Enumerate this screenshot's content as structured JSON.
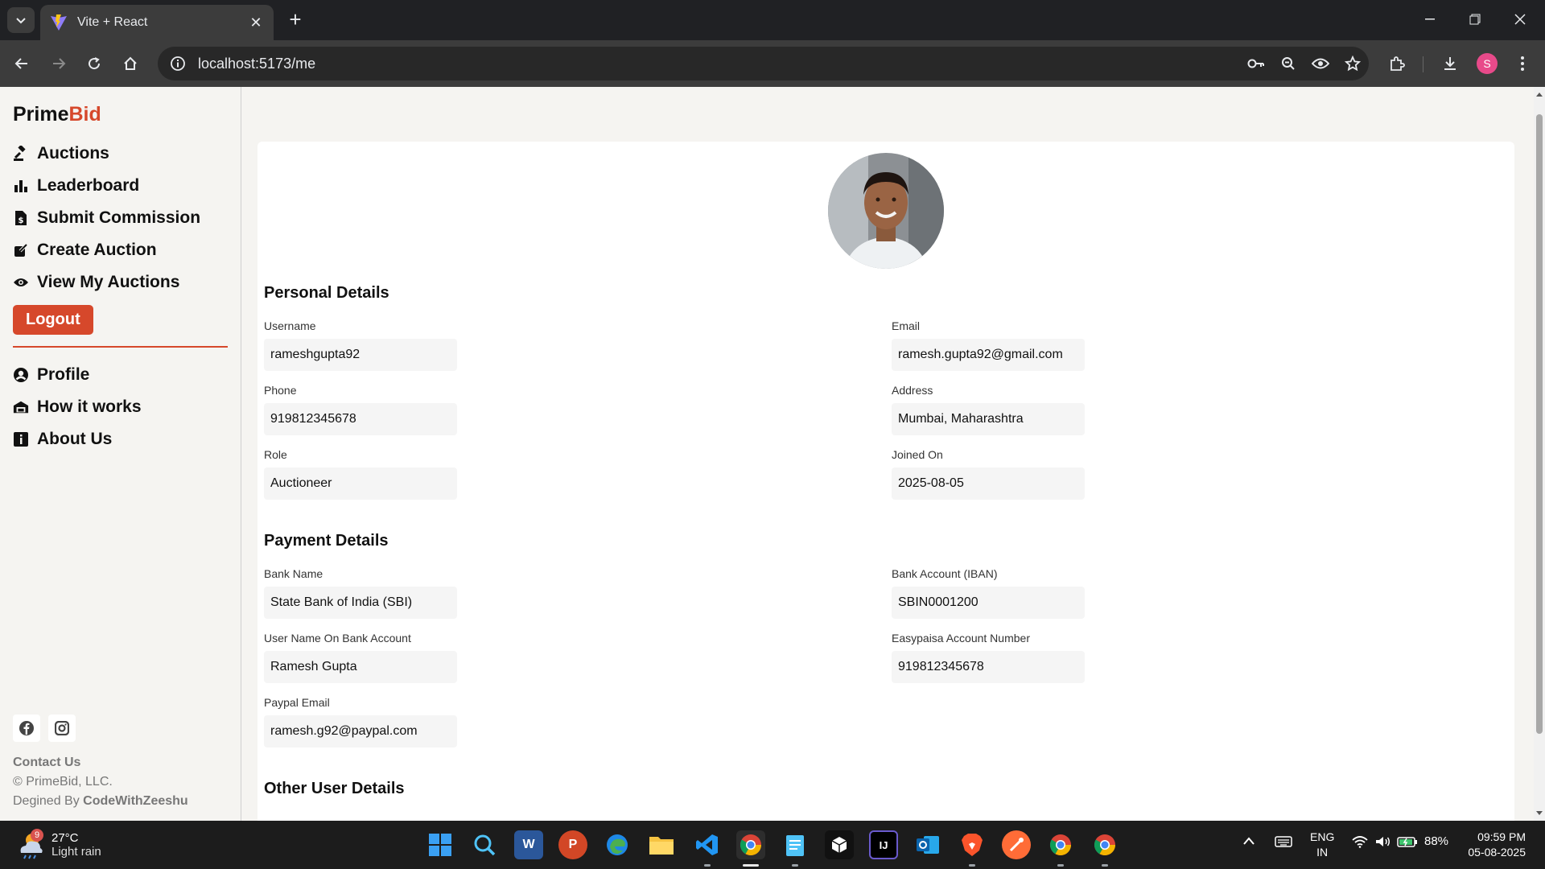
{
  "browser": {
    "tab_title": "Vite + React",
    "url": "localhost:5173/me",
    "profile_initial": "S"
  },
  "sidebar": {
    "brand_prefix": "Prime",
    "brand_accent": "Bid",
    "nav": [
      {
        "label": "Auctions",
        "icon": "gavel-icon"
      },
      {
        "label": "Leaderboard",
        "icon": "bar-chart-icon"
      },
      {
        "label": "Submit Commission",
        "icon": "file-dollar-icon"
      },
      {
        "label": "Create Auction",
        "icon": "edit-icon"
      },
      {
        "label": "View My Auctions",
        "icon": "eye-icon"
      }
    ],
    "logout_label": "Logout",
    "nav2": [
      {
        "label": "Profile",
        "icon": "user-circle-icon"
      },
      {
        "label": "How it works",
        "icon": "garage-icon"
      },
      {
        "label": "About Us",
        "icon": "info-icon"
      }
    ],
    "contact": "Contact Us",
    "copyright": "© PrimeBid, LLC.",
    "designed_by_prefix": "Degined By ",
    "designed_by_name": "CodeWithZeeshu"
  },
  "profile": {
    "personal_title": "Personal Details",
    "personal": [
      {
        "label": "Username",
        "value": "rameshgupta92"
      },
      {
        "label": "Email",
        "value": "ramesh.gupta92@gmail.com"
      },
      {
        "label": "Phone",
        "value": "919812345678"
      },
      {
        "label": "Address",
        "value": "Mumbai, Maharashtra"
      },
      {
        "label": "Role",
        "value": "Auctioneer"
      },
      {
        "label": "Joined On",
        "value": "2025-08-05"
      }
    ],
    "payment_title": "Payment Details",
    "payment": [
      {
        "label": "Bank Name",
        "value": "State Bank of India (SBI)"
      },
      {
        "label": "Bank Account (IBAN)",
        "value": "SBIN0001200"
      },
      {
        "label": "User Name On Bank Account",
        "value": "Ramesh Gupta"
      },
      {
        "label": "Easypaisa Account Number",
        "value": "919812345678"
      },
      {
        "label": "Paypal Email",
        "value": "ramesh.g92@paypal.com"
      }
    ],
    "other_title": "Other User Details"
  },
  "taskbar": {
    "weather_badge": "9",
    "temperature": "27°C",
    "condition": "Light rain",
    "lang_top": "ENG",
    "lang_bottom": "IN",
    "battery": "88%",
    "time": "09:59 PM",
    "date": "05-08-2025"
  },
  "colors": {
    "accent": "#d6482b",
    "page_bg": "#f5f4f1",
    "field_bg": "#f5f5f5"
  }
}
